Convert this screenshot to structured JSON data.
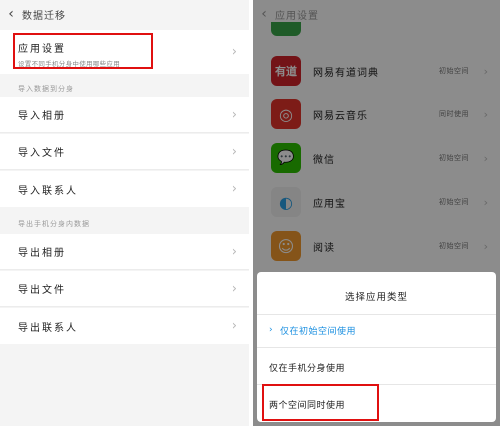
{
  "left": {
    "header": {
      "back_icon": "chevron-left-icon",
      "title": "数据迁移"
    },
    "app_settings": {
      "label": "应用设置",
      "sub": "设置不同手机分身中使用哪些应用"
    },
    "import_section": "导入数据到分身",
    "import_items": [
      "导入相册",
      "导入文件",
      "导入联系人"
    ],
    "export_section": "导出手机分身内数据",
    "export_items": [
      "导出相册",
      "导出文件",
      "导出联系人"
    ]
  },
  "right": {
    "header": {
      "back_icon": "chevron-left-icon",
      "title": "应用设置"
    },
    "apps": [
      {
        "name": "网易有道词典",
        "mode": "初始空间",
        "icon_text": "有道",
        "color": "#d2232a"
      },
      {
        "name": "网易云音乐",
        "mode": "同时使用",
        "icon_text": "◎",
        "color": "#e4342b"
      },
      {
        "name": "微信",
        "mode": "初始空间",
        "icon_text": "💬",
        "color": "#2dc100"
      },
      {
        "name": "应用宝",
        "mode": "初始空间",
        "icon_text": "◐",
        "color": "#f2f2f2"
      },
      {
        "name": "阅读",
        "mode": "初始空间",
        "icon_text": "☺",
        "color": "#f29a2e"
      }
    ],
    "sheet": {
      "title": "选择应用类型",
      "options": [
        {
          "label": "仅在初始空间使用",
          "selected": true
        },
        {
          "label": "仅在手机分身使用",
          "selected": false
        },
        {
          "label": "两个空间同时使用",
          "selected": false
        }
      ]
    },
    "accent": "#1a8fe0",
    "highlight": "#e01010"
  }
}
